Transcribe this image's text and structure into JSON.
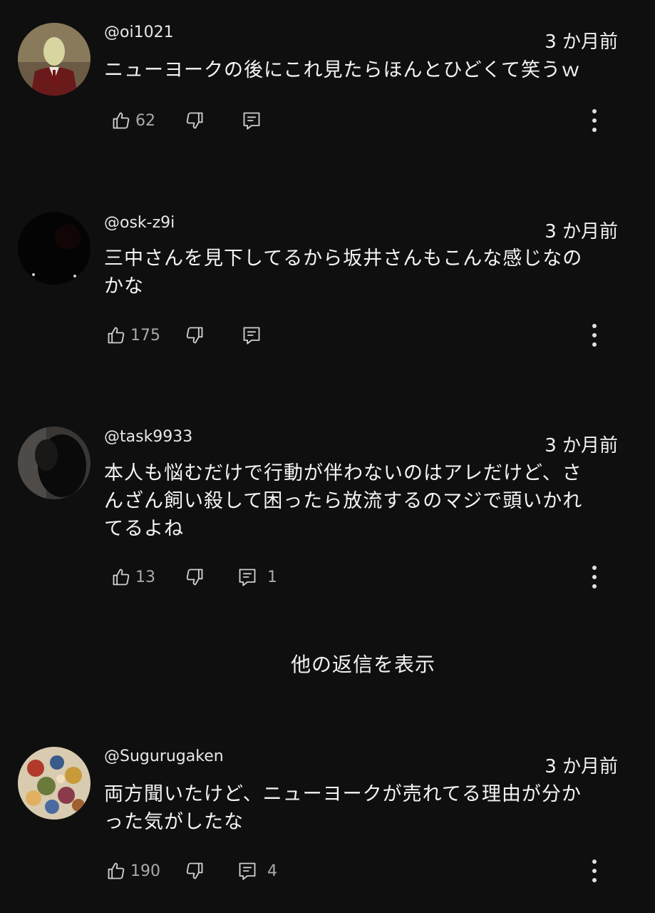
{
  "comments": [
    {
      "handle": "@oi1021",
      "time": "3 か月前",
      "text": "ニューヨークの後にこれ見たらほんとひどくて笑うｗ",
      "likes": "62",
      "replies": ""
    },
    {
      "handle": "@osk-z9i",
      "time": "3 か月前",
      "text": "三中さんを見下してるから坂井さんもこんな感じなの\nかな",
      "likes": "175",
      "replies": ""
    },
    {
      "handle": "@task9933",
      "time": "3 か月前",
      "text": "本人も悩むだけで行動が伴わないのはアレだけど、さ\nんざん飼い殺して困ったら放流するのマジで頭いかれ\nてるよね",
      "likes": "13",
      "replies": "1"
    },
    {
      "handle": "@Sugurugaken",
      "time": "3 か月前",
      "text": "両方聞いたけど、ニューヨークが売れてる理由が分か\nった気がしたな",
      "likes": "190",
      "replies": "4"
    }
  ],
  "show_more_replies": "他の返信を表示",
  "icons": {
    "like": "thumbs-up-icon",
    "dislike": "thumbs-down-icon",
    "reply": "comment-icon",
    "more": "more-vertical-icon"
  },
  "colors": {
    "background": "#0f0f0f",
    "text": "#f1f1f1",
    "secondary": "#aaaaaa"
  }
}
